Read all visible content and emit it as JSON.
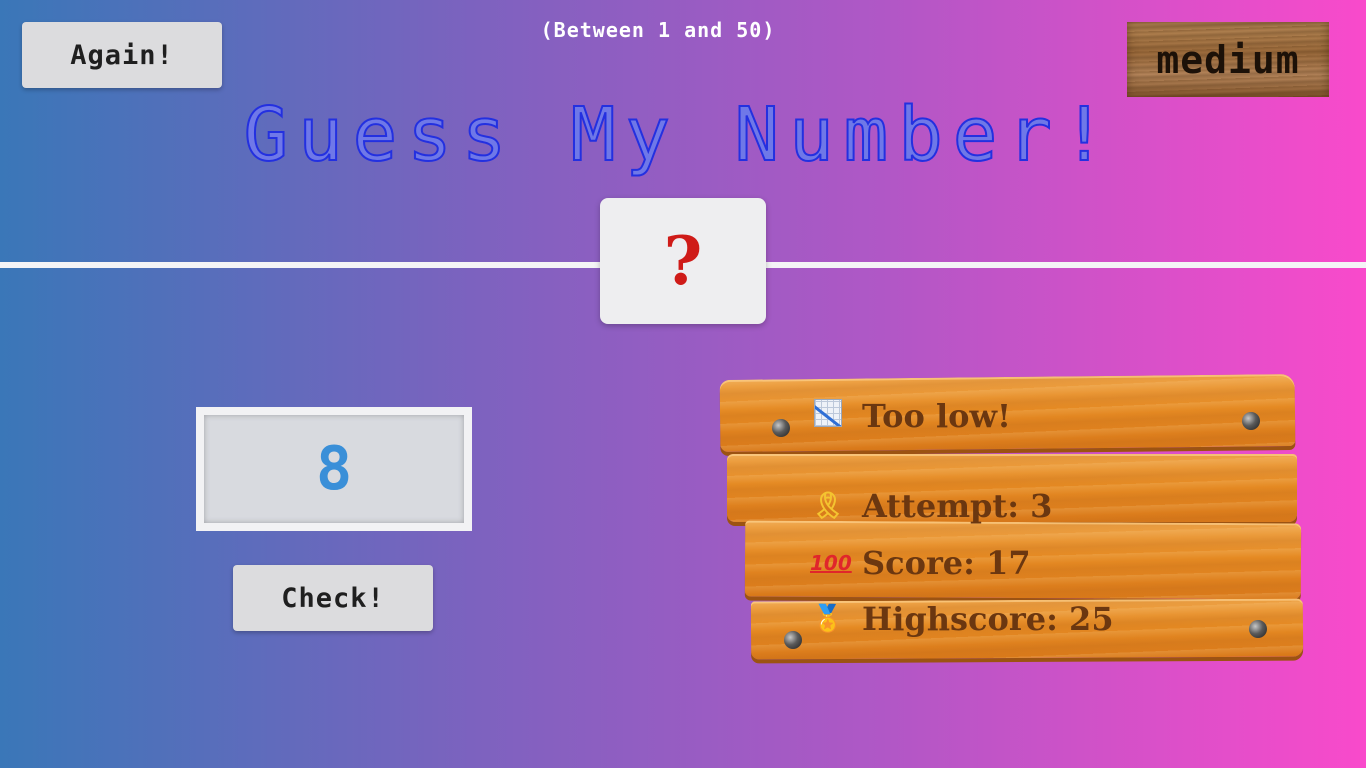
{
  "header": {
    "again_label": "Again!",
    "range_text": "(Between 1 and 50)",
    "difficulty_label": "medium",
    "title": "Guess My Number!"
  },
  "secret": {
    "display": "?"
  },
  "guess": {
    "value": "8",
    "check_label": "Check!"
  },
  "board": {
    "message": "Too low!",
    "attempt_label": "Attempt:",
    "attempt_value": "3",
    "score_label": "Score:",
    "score_value": "17",
    "highscore_label": "Highscore:",
    "highscore_value": "25",
    "icons": {
      "message": "chart-decreasing-icon",
      "attempt": "ribbon-icon",
      "score": "hundred-points-icon",
      "highscore": "medal-icon"
    }
  },
  "colors": {
    "background_start": "#3a77b8",
    "background_end": "#f94acb",
    "title_color": "#2330e0",
    "secret_color": "#cf1b18",
    "guess_color": "#3a8fd8",
    "board_text": "#6b3710",
    "wood": "#e58a23"
  }
}
